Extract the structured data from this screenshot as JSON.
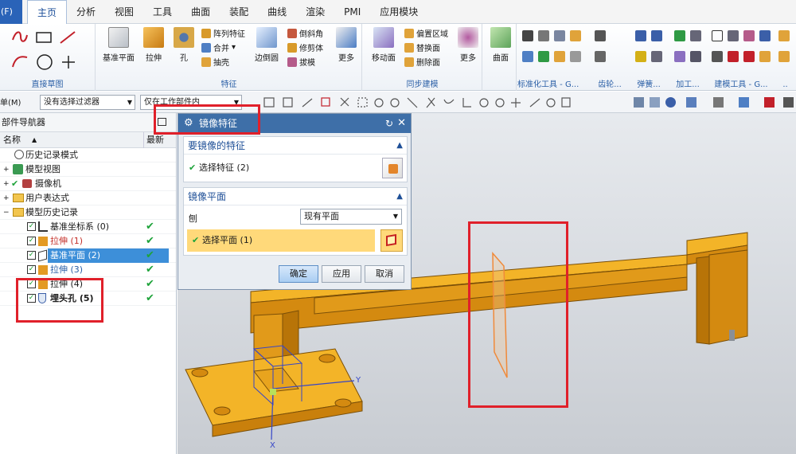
{
  "menubar": {
    "file_label": "(F)",
    "tabs": [
      "主页",
      "分析",
      "视图",
      "工具",
      "曲面",
      "装配",
      "曲线",
      "渲染",
      "PMI",
      "应用模块"
    ]
  },
  "ribbon": {
    "sketch_group": {
      "label": "直接草图"
    },
    "feature_group": {
      "label": "特征",
      "big": [
        "基准平面",
        "拉伸",
        "孔",
        "边倒圆",
        "更多"
      ],
      "small": [
        "阵列特征",
        "合并",
        "抽壳",
        "倒斜角",
        "修剪体",
        "拔模"
      ]
    },
    "sync_group": {
      "label": "同步建模",
      "big": [
        "移动面",
        "更多"
      ],
      "small": [
        "偏置区域",
        "替换面",
        "删除面"
      ]
    },
    "surface_group": {
      "big": [
        "曲面"
      ]
    },
    "right_groups": [
      "标准化工具 - G...",
      "齿轮...",
      "弹簧...",
      "加工...",
      "建模工具 - G...",
      ".."
    ]
  },
  "toolbar2": {
    "menu_label": "单(M)",
    "filter_label": "没有选择过滤器",
    "scope_label": "仅在工作部件内"
  },
  "navigator": {
    "title": "部件导航器",
    "col_name": "名称",
    "col_latest": "最新",
    "items": [
      {
        "label": "历史记录模式"
      },
      {
        "label": "模型视图"
      },
      {
        "label": "摄像机"
      },
      {
        "label": "用户表达式"
      },
      {
        "label": "模型历史记录"
      },
      {
        "label": "基准坐标系 (0)"
      },
      {
        "label": "拉伸 (1)"
      },
      {
        "label": "基准平面 (2)"
      },
      {
        "label": "拉伸 (3)"
      },
      {
        "label": "拉伸 (4)"
      },
      {
        "label": "埋头孔 (5)"
      }
    ]
  },
  "dialog": {
    "title": "镜像特征",
    "section1": {
      "title": "要镜像的特征",
      "select_label": "选择特征 (2)"
    },
    "section2": {
      "title": "镜像平面",
      "plane_label": "刨",
      "plane_value": "现有平面",
      "select_plane": "选择平面 (1)"
    },
    "buttons": {
      "ok": "确定",
      "apply": "应用",
      "cancel": "取消"
    }
  },
  "viewport": {
    "axis_x": "X",
    "axis_y": "Y"
  },
  "colors": {
    "accent": "#2a63b8",
    "model": "#e6a014",
    "highlight": "#e0202a",
    "selection": "#ffd97a"
  }
}
